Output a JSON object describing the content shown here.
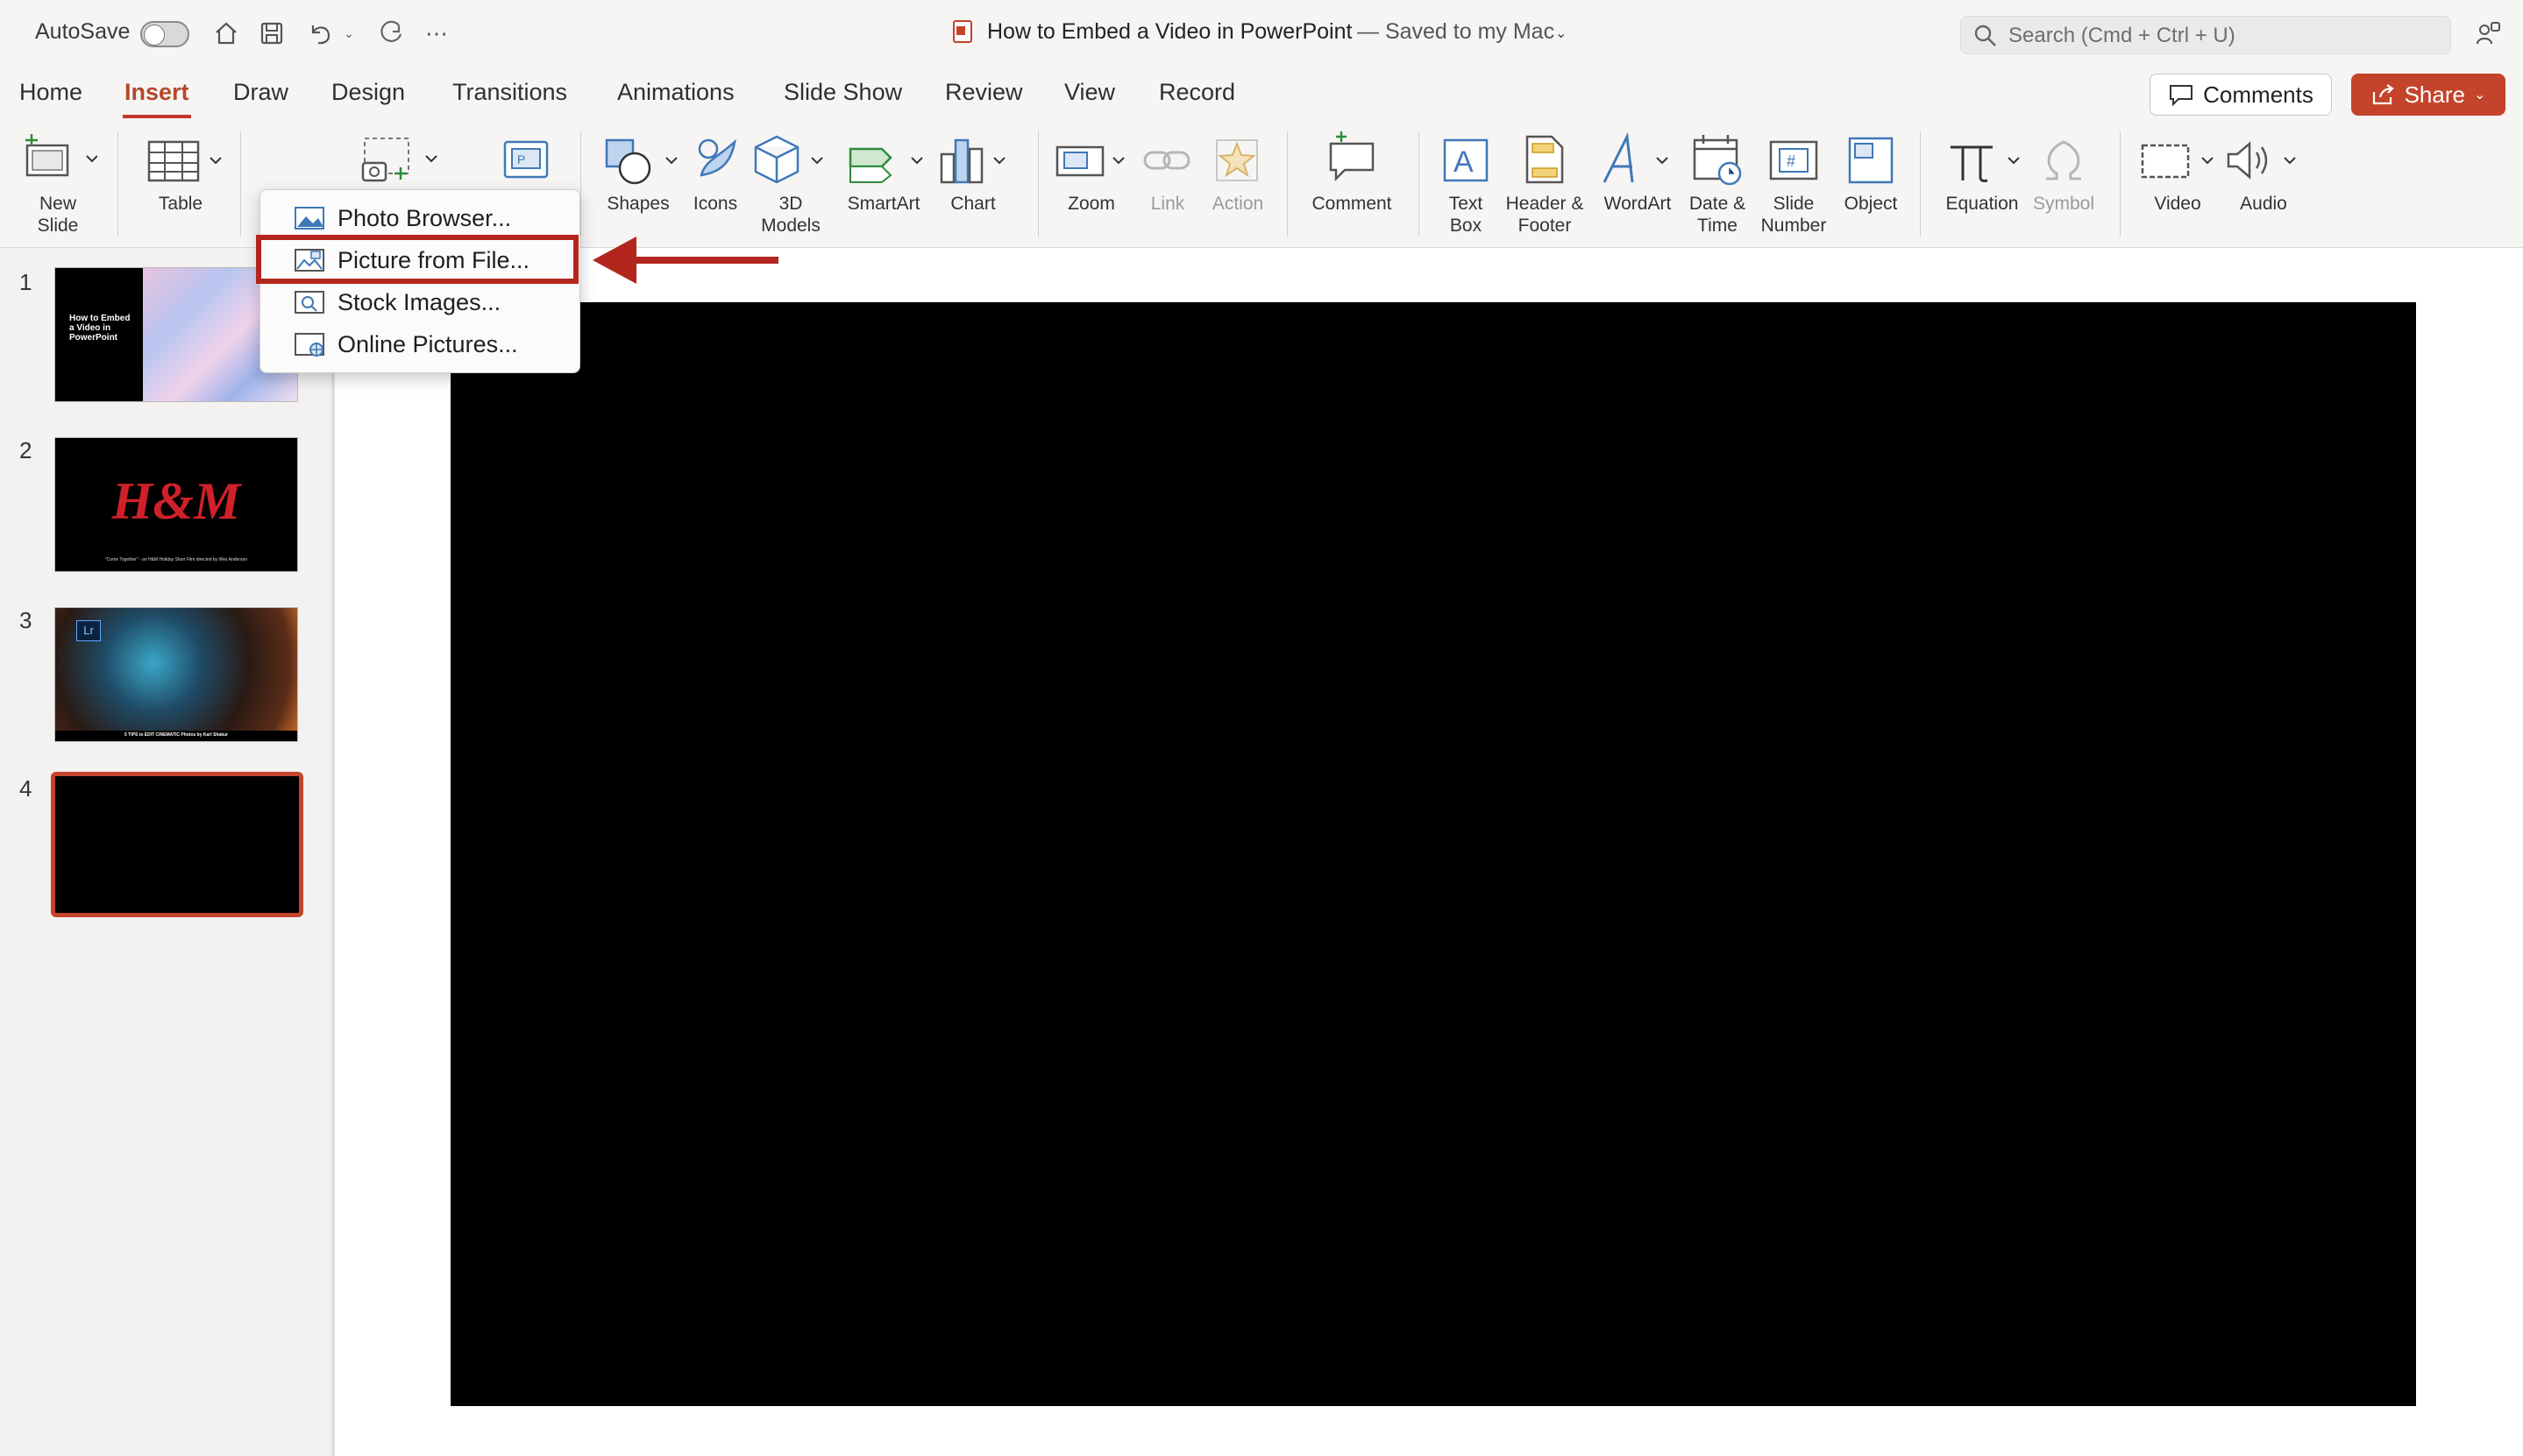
{
  "titlebar": {
    "autosave_label": "AutoSave",
    "document_title": "How to Embed a Video in PowerPoint",
    "save_status": "— Saved to my Mac",
    "search_placeholder": "Search (Cmd + Ctrl + U)"
  },
  "tabs": [
    "Home",
    "Insert",
    "Draw",
    "Design",
    "Transitions",
    "Animations",
    "Slide Show",
    "Review",
    "View",
    "Record"
  ],
  "active_tab": "Insert",
  "header_buttons": {
    "comments": "Comments",
    "share": "Share"
  },
  "ribbon": {
    "new_slide": "New\nSlide",
    "table": "Table",
    "shapes": "Shapes",
    "icons": "Icons",
    "models_3d": "3D\nModels",
    "smartart": "SmartArt",
    "chart": "Chart",
    "zoom": "Zoom",
    "link": "Link",
    "action": "Action",
    "comment": "Comment",
    "text_box": "Text\nBox",
    "header_footer": "Header &\nFooter",
    "wordart": "WordArt",
    "date_time": "Date &\nTime",
    "slide_number": "Slide\nNumber",
    "object": "Object",
    "equation": "Equation",
    "symbol": "Symbol",
    "video": "Video",
    "audio": "Audio"
  },
  "picture_menu": {
    "items": [
      "Photo Browser...",
      "Picture from File...",
      "Stock Images...",
      "Online Pictures..."
    ],
    "highlighted": "Picture from File..."
  },
  "slides": [
    {
      "number": "1",
      "title_text": "How to Embed a Video in PowerPoint"
    },
    {
      "number": "2",
      "logo_text": "H&M",
      "caption": "\"Come Together\" - an H&M Holiday Short Film directed by Wes Anderson"
    },
    {
      "number": "3",
      "badge": "Lr",
      "caption": "5 TIPS to EDIT CINEMATIC Photos by Karl Shakur"
    },
    {
      "number": "4"
    }
  ],
  "colors": {
    "accent": "#c4432b",
    "active_tab": "#b7472a",
    "highlight": "#b3261e",
    "slide_bg": "#000000"
  }
}
